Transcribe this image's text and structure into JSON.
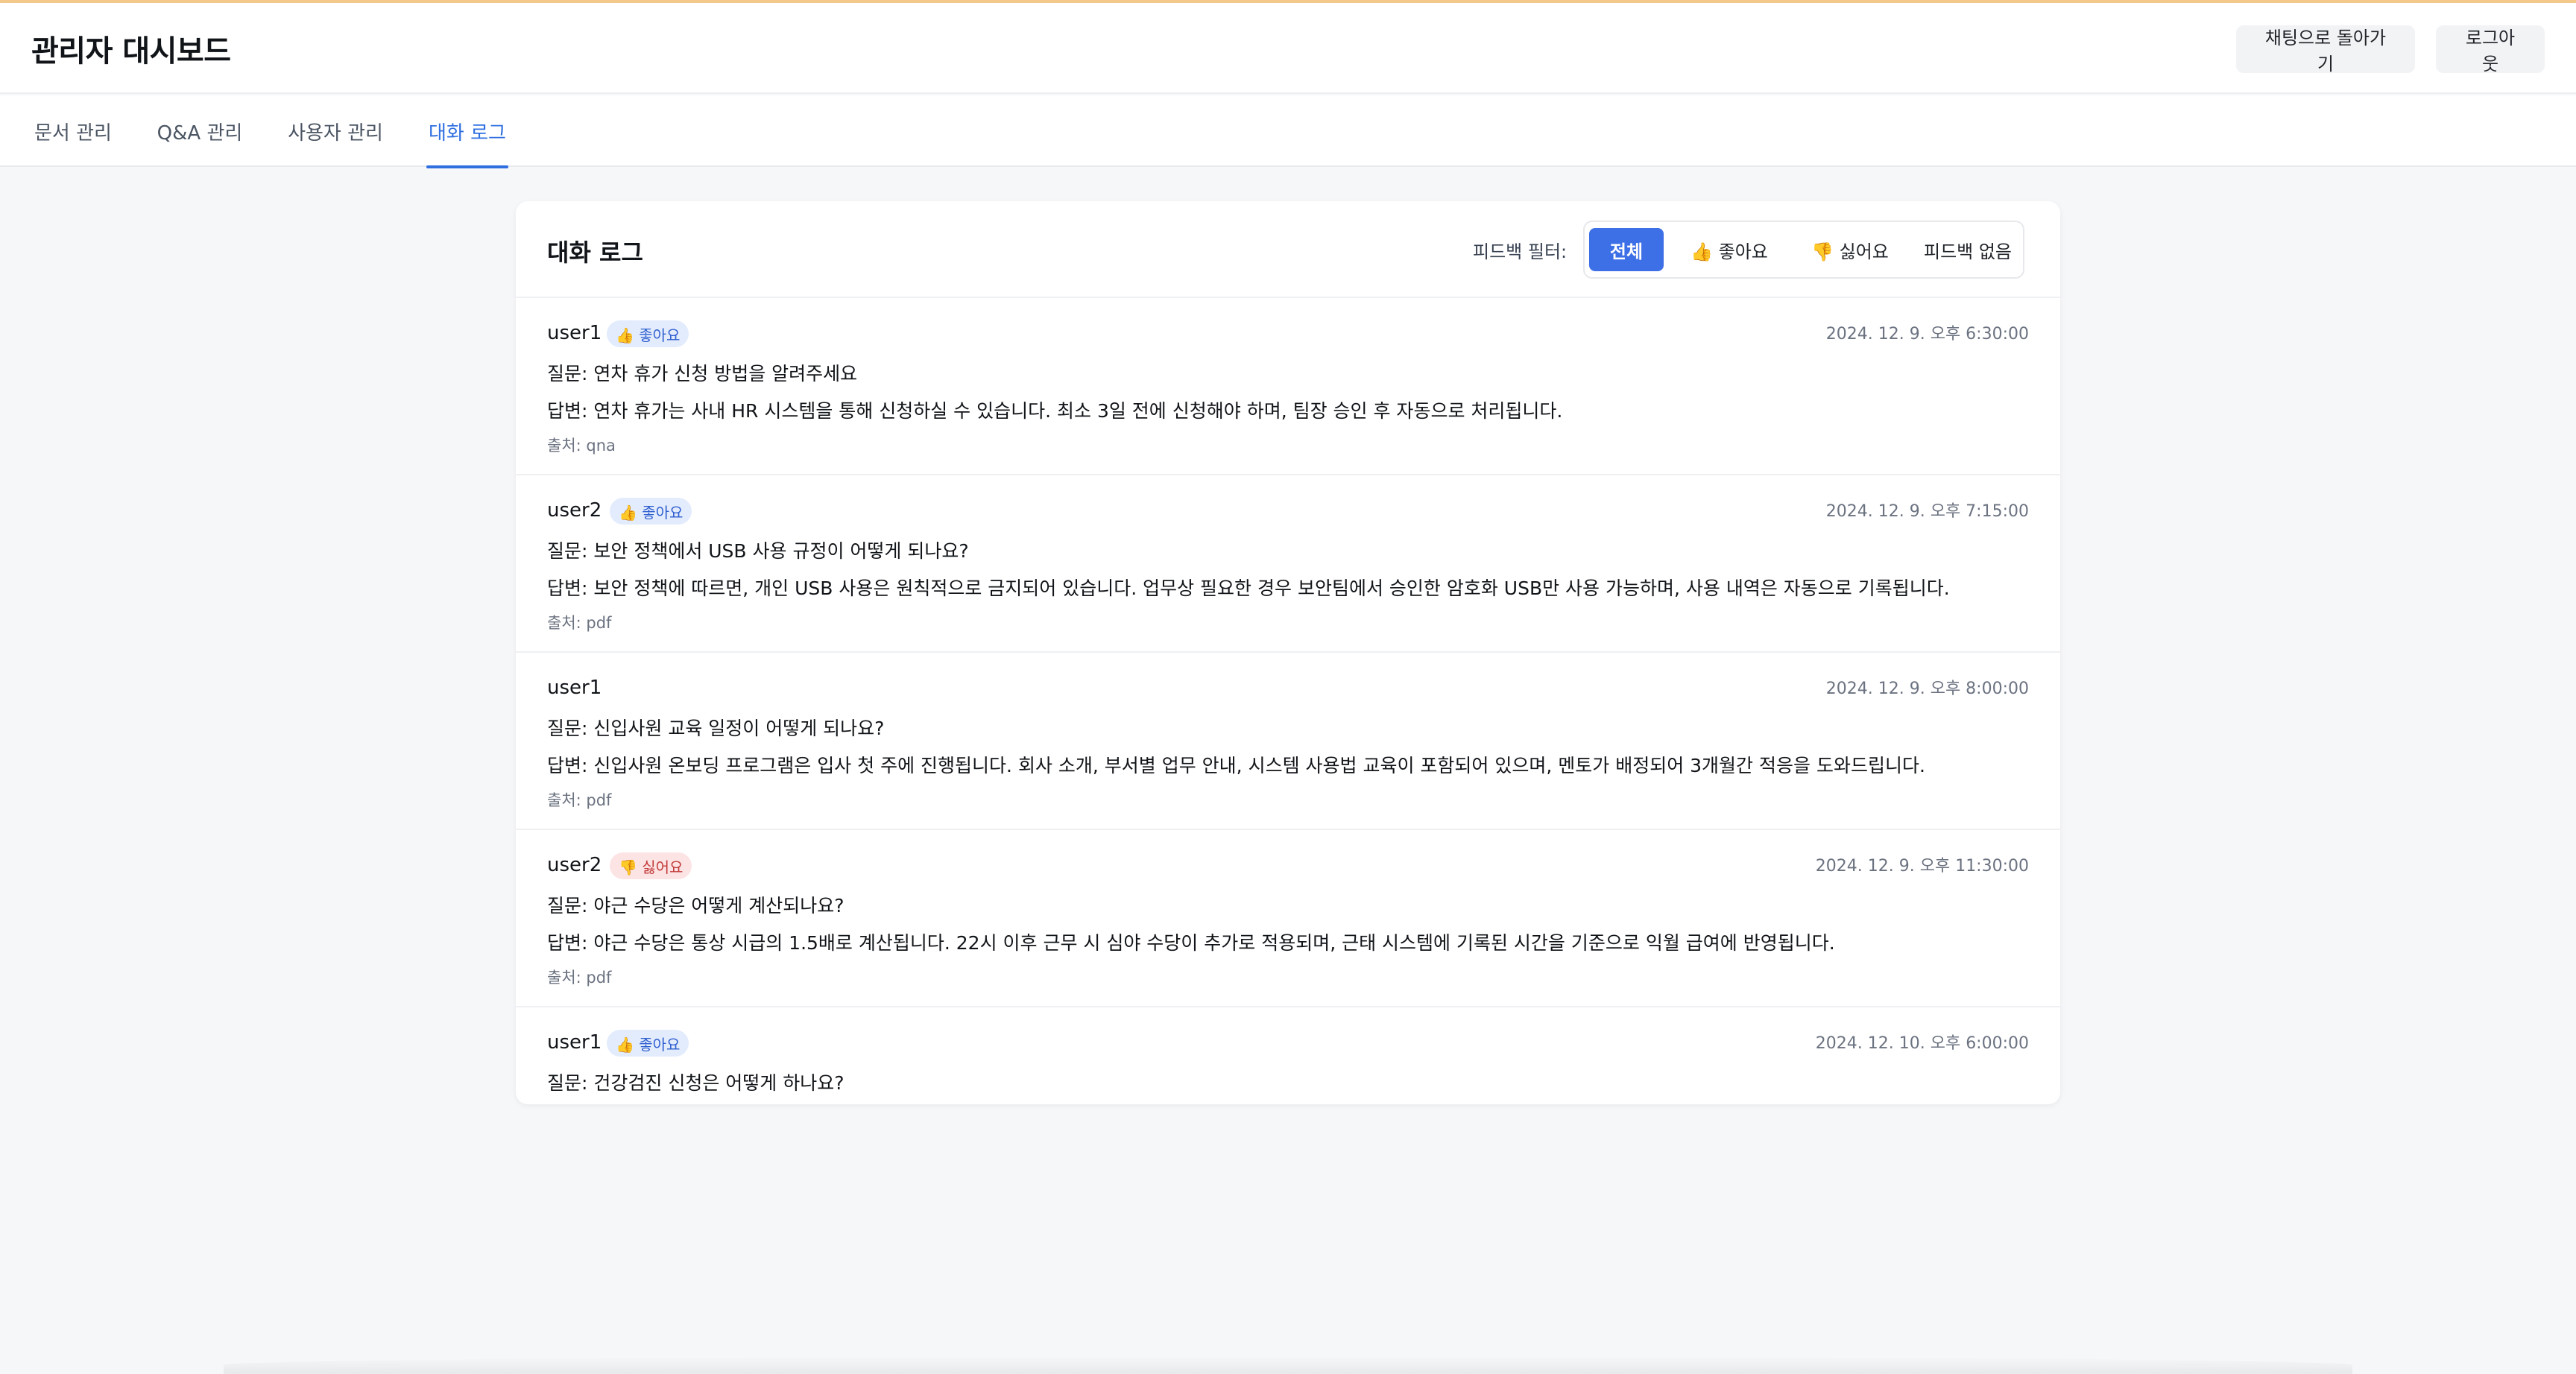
{
  "header": {
    "title": "관리자 대시보드",
    "back_label": "채팅으로 돌아가기",
    "logout_label": "로그아웃"
  },
  "tabs": [
    {
      "label": "문서 관리",
      "active": false
    },
    {
      "label": "Q&A 관리",
      "active": false
    },
    {
      "label": "사용자 관리",
      "active": false
    },
    {
      "label": "대화 로그",
      "active": true
    }
  ],
  "panel": {
    "title": "대화 로그",
    "filter_label": "피드백 필터:",
    "filters": [
      {
        "label": "전체",
        "active": true
      },
      {
        "label": "👍 좋아요",
        "active": false
      },
      {
        "label": "👎 싫어요",
        "active": false
      },
      {
        "label": "피드백 없음",
        "active": false
      }
    ]
  },
  "logs": [
    {
      "user": "user1",
      "feedback": "like",
      "badge": "👍 좋아요",
      "time": "2024. 12. 9. 오후 6:30:00",
      "question": "질문: 연차 휴가 신청 방법을 알려주세요",
      "answer": "답변: 연차 휴가는 사내 HR 시스템을 통해 신청하실 수 있습니다. 최소 3일 전에 신청해야 하며, 팀장 승인 후 자동으로 처리됩니다.",
      "source": "출처: qna"
    },
    {
      "user": "user2",
      "feedback": "like",
      "badge": "👍 좋아요",
      "time": "2024. 12. 9. 오후 7:15:00",
      "question": "질문: 보안 정책에서 USB 사용 규정이 어떻게 되나요?",
      "answer": "답변: 보안 정책에 따르면, 개인 USB 사용은 원칙적으로 금지되어 있습니다. 업무상 필요한 경우 보안팀에서 승인한 암호화 USB만 사용 가능하며, 사용 내역은 자동으로 기록됩니다.",
      "source": "출처: pdf"
    },
    {
      "user": "user1",
      "feedback": "none",
      "badge": "",
      "time": "2024. 12. 9. 오후 8:00:00",
      "question": "질문: 신입사원 교육 일정이 어떻게 되나요?",
      "answer": "답변: 신입사원 온보딩 프로그램은 입사 첫 주에 진행됩니다. 회사 소개, 부서별 업무 안내, 시스템 사용법 교육이 포함되어 있으며, 멘토가 배정되어 3개월간 적응을 도와드립니다.",
      "source": "출처: pdf"
    },
    {
      "user": "user2",
      "feedback": "dislike",
      "badge": "👎 싫어요",
      "time": "2024. 12. 9. 오후 11:30:00",
      "question": "질문: 야근 수당은 어떻게 계산되나요?",
      "answer": "답변: 야근 수당은 통상 시급의 1.5배로 계산됩니다. 22시 이후 근무 시 심야 수당이 추가로 적용되며, 근태 시스템에 기록된 시간을 기준으로 익월 급여에 반영됩니다.",
      "source": "출처: pdf"
    },
    {
      "user": "user1",
      "feedback": "like",
      "badge": "👍 좋아요",
      "time": "2024. 12. 10. 오후 6:00:00",
      "question": "질문: 건강검진 신청은 어떻게 하나요?",
      "answer": "",
      "source": ""
    }
  ]
}
